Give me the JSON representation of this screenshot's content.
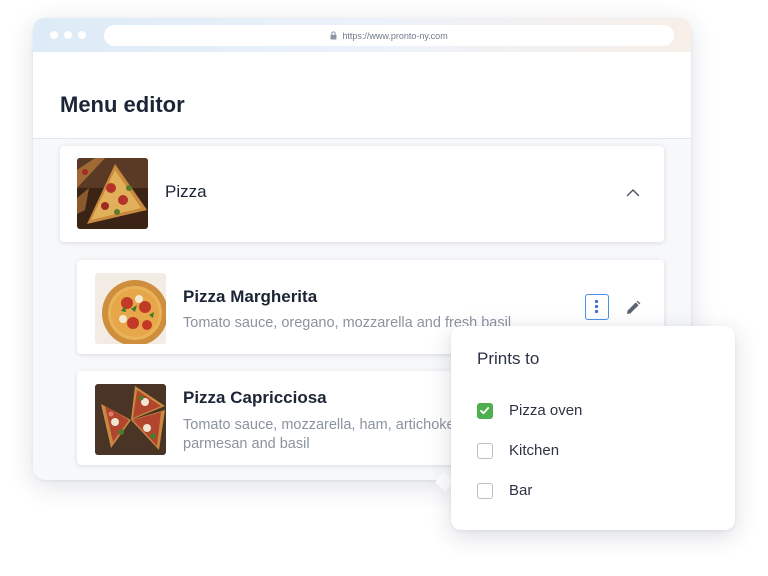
{
  "browser": {
    "url": "https://www.pronto-ny.com"
  },
  "page": {
    "title": "Menu editor"
  },
  "category": {
    "name": "Pizza",
    "expanded": true,
    "icon": "chevron-up-icon"
  },
  "items": [
    {
      "name": "Pizza Margherita",
      "description": "Tomato sauce, oregano, mozzarella and fresh basil"
    },
    {
      "name": "Pizza Capricciosa",
      "description_line1": "Tomato sauce, mozzarella, ham, artichokes,",
      "description_line2": "parmesan and basil"
    }
  ],
  "item_actions": {
    "more_icon": "kebab-menu-icon",
    "edit_icon": "pencil-icon"
  },
  "prints_to": {
    "title": "Prints to",
    "options": [
      {
        "label": "Pizza oven",
        "checked": true
      },
      {
        "label": "Kitchen",
        "checked": false
      },
      {
        "label": "Bar",
        "checked": false
      }
    ]
  },
  "colors": {
    "accent_blue": "#4f8fe8",
    "check_green": "#4caf50",
    "title_text": "#1c2535",
    "muted_text": "#8b939e"
  }
}
